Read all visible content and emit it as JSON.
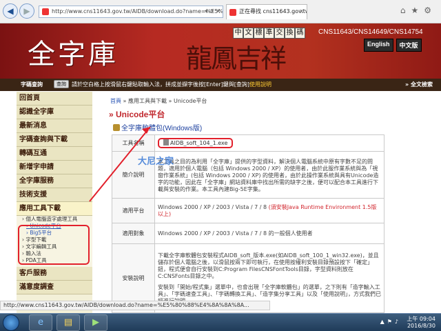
{
  "browser": {
    "url": "http://www.cns11643.gov.tw/AIDB/download.do?name=%E5%",
    "tab_title": "正在尋找 cns11643.gov.tw",
    "back_icon": "back-arrow-icon",
    "forward_icon": "forward-arrow-icon"
  },
  "header": {
    "logo": "全字庫",
    "brush_text": "龍鳳吉祥",
    "code_chars": [
      "中",
      "文",
      "標",
      "準",
      "交",
      "換",
      "碼"
    ],
    "standards": "CNS11643/CNS14649/CNS14754",
    "lang_en": "English",
    "lang_zh": "中文版"
  },
  "searchbar": {
    "label": "字碼查詢",
    "button": "查詢",
    "hint": "請於空白格上按滑鼠右鍵貼取輸入法，拼成並擷字後按[Enter]鍵與[查詢]",
    "hint_link": "使用說明",
    "fulltext": "全文檢索"
  },
  "sidebar": {
    "items": [
      "回首頁",
      "認識全字庫",
      "最新消息",
      "字碼查詢與下載",
      "轉碼互通",
      "新增字申請",
      "全字庫服務",
      "技術支援",
      "應用工具下載"
    ],
    "subs": [
      "個人電腦造字處理工具",
      "Unicode平台",
      "Big5平台",
      "字型下載",
      "文字編輯工具",
      "輸入法",
      "PDA工具"
    ],
    "bottom": [
      "客戶服務",
      "滿意度調查"
    ]
  },
  "content": {
    "crumb_home": "首頁",
    "crumb_mid": "應用工具與下載",
    "crumb_cur": "Unicode平台",
    "title": "Unicode平台",
    "download_link": "全字庫軟體包(Windows版)",
    "rows": {
      "filename_label": "工具名稱",
      "filename": "AIDB_soft_104_1.exe",
      "desc_label": "簡介說明",
      "desc": "本工具之目的為利用「全字庫」提供的字型資料，解決個人電腦系統中原有字數不足的問題，適用於個人電腦（包括 Windows 2000 / XP）的使用者，由於此服作業系統與為「視窗作業系統」(包括 Windows 2000 / XP) 的使用者，由於此操作業系統與具有Unicode造字的功能，因此在「全字庫」網站資料庫中找出所需的缺字之後，便可以配合本工具進行下載與安裝的作業。本工具內建Big-5E字集。",
      "platform_label": "適用平台",
      "platform": "Windows 2000 / XP / 2003 / Vista / 7 / 8 ",
      "platform_note": "(須安裝Java Runtime Environment 1.5版以上)",
      "target_label": "適用對象",
      "target": "Windows 2000 / XP / 2003 / Vista / 7 / 8 的一般個人使用者",
      "install_label": "安裝說明",
      "install_1": "下載全字庫軟體包安裝程式AIDB_soft_版本.exe(如AIDB_soft_100_1_win32.exe)，並且儲存於個人電腦之後，以滑鼠按兩下即可執行，在使用按權利安裝目錄預設按下「確定」鈕，程式便會自行安裝到C:Program FilesCNSFontTools目錄，字型資料則放在C:CNSFonts目錄之中。",
      "install_2": "安裝到「開始/程式集」選單中，也會出現「全字庫軟體包」的選單，之下則有「造字輸入工具」、「字碼速查工具」、「字碼轉換工具」、「造字集分享工具」以及「使用說明」，方式我們已經進行說明。"
    },
    "watermark": "大尼之家"
  },
  "status_url": "http://www.cns11643.gov.tw/AIDB/download.do?name=%E5%80%88%E4%8A%8A%8A...",
  "taskbar": {
    "time": "上午 09:04",
    "date": "2016/8/30",
    "app1_icon": "internet-explorer-icon",
    "app2_icon": "file-explorer-icon",
    "app3_icon": "media-player-icon"
  }
}
